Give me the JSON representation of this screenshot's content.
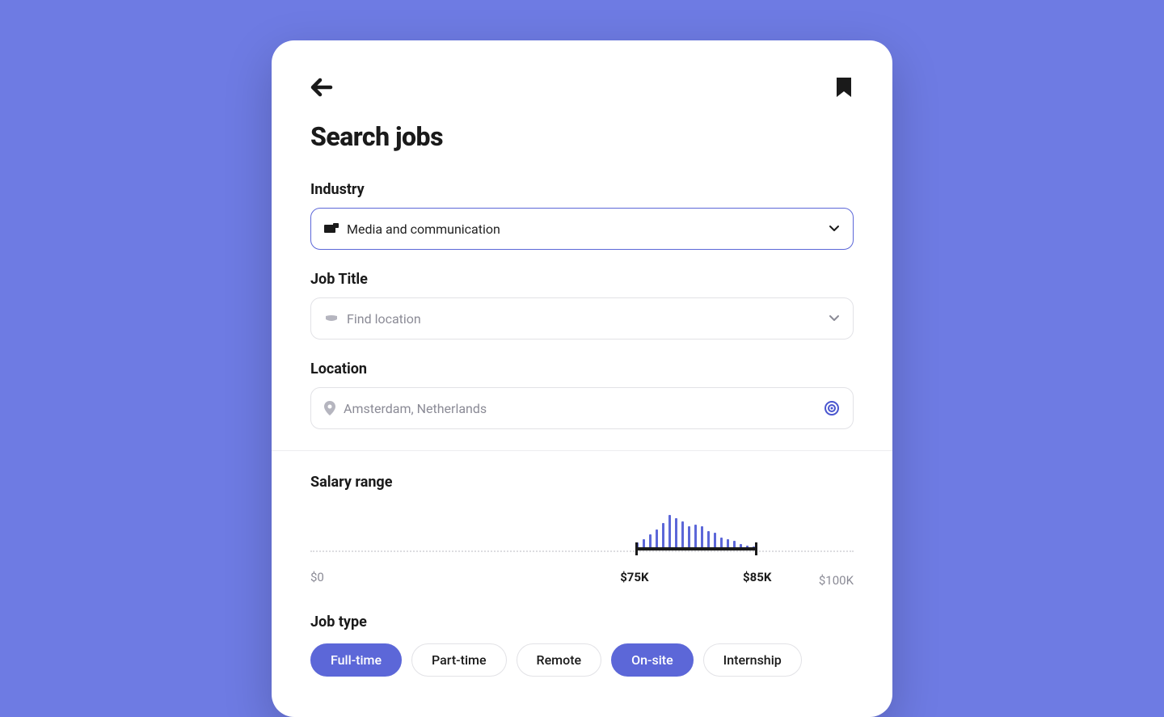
{
  "title": "Search jobs",
  "fields": {
    "industry": {
      "label": "Industry",
      "value": "Media and communication"
    },
    "job_title": {
      "label": "Job Title",
      "placeholder": "Find location"
    },
    "location": {
      "label": "Location",
      "value": "Amsterdam, Netherlands"
    }
  },
  "salary": {
    "label": "Salary range",
    "min_label": "$0",
    "max_label": "$100K",
    "low_label": "$75K",
    "high_label": "$85K",
    "low_pct": 60,
    "high_pct": 82,
    "bars": [
      10,
      14,
      20,
      26,
      34,
      44,
      40,
      36,
      30,
      32,
      30,
      24,
      22,
      16,
      14,
      12,
      8,
      6,
      5
    ]
  },
  "job_type": {
    "label": "Job type",
    "options": [
      {
        "label": "Full-time",
        "active": true
      },
      {
        "label": "Part-time",
        "active": false
      },
      {
        "label": "Remote",
        "active": false
      },
      {
        "label": "On-site",
        "active": true
      },
      {
        "label": "Internship",
        "active": false
      }
    ]
  }
}
